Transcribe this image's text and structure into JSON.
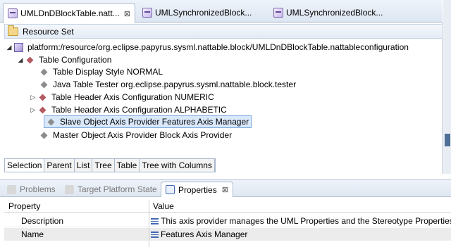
{
  "editor_tabs": [
    {
      "label": "UMLDnDBlockTable.natt...",
      "active": true,
      "close": "⊠"
    },
    {
      "label": "UMLSynchronizedBlock...",
      "active": false
    },
    {
      "label": "UMLSynchronizedBlock...",
      "active": false
    }
  ],
  "resource_set_label": "Resource Set",
  "tree": {
    "root": "platform:/resource/org.eclipse.papyrus.sysml.nattable.block/UMLDnDBlockTable.nattableconfiguration",
    "config": "Table Configuration",
    "children": [
      "Table Display Style NORMAL",
      "Java Table Tester org.eclipse.papyrus.sysml.nattable.block.tester",
      "Table Header Axis Configuration NUMERIC",
      "Table Header Axis Configuration ALPHABETIC",
      "Slave Object Axis Provider Features Axis Manager",
      "Master Object Axis Provider Block Axis Provider"
    ]
  },
  "bottom_tabs": [
    "Selection",
    "Parent",
    "List",
    "Tree",
    "Table",
    "Tree with Columns"
  ],
  "view_tabs": [
    {
      "label": "Problems",
      "active": false
    },
    {
      "label": "Target Platform State",
      "active": false
    },
    {
      "label": "Properties",
      "active": true,
      "close": "⊠"
    }
  ],
  "properties": {
    "col_property": "Property",
    "col_value": "Value",
    "rows": [
      {
        "property": "Description",
        "value": "This axis provider manages the UML Properties and the Stereotype Properties"
      },
      {
        "property": "Name",
        "value": "Features Axis Manager"
      }
    ]
  }
}
